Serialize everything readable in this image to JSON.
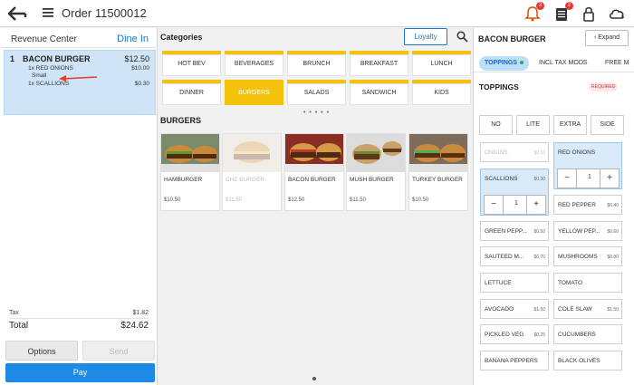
{
  "header": {
    "title": "Order 11500012",
    "notification_badge": "3",
    "orders_badge": "2",
    "badge_color": "#e53935"
  },
  "left_panel": {
    "revenue_center_label": "Revenue Center",
    "dine_in_label": "Dine In",
    "order_item": {
      "qty": "1",
      "name": "BACON BURGER",
      "price": "$12.50",
      "modifiers": [
        {
          "text": "1x RED ONIONS",
          "price": "$10.00"
        },
        {
          "text": "Small",
          "price": ""
        },
        {
          "text": "1x SCALLIONS",
          "price": "$0.30"
        }
      ]
    },
    "tax_label": "Tax",
    "tax_value": "$1.82",
    "total_label": "Total",
    "total_value": "$24.62",
    "options_label": "Options",
    "send_label": "Send",
    "pay_label": "Pay",
    "pay_color": "#1e88e5"
  },
  "middle_panel": {
    "categories_title": "Categories",
    "loyalty_label": "Loyalty",
    "categories": [
      {
        "label": "HOT BEV",
        "active": false
      },
      {
        "label": "BEVERAGES",
        "active": false
      },
      {
        "label": "BRUNCH",
        "active": false
      },
      {
        "label": "BREAKFAST",
        "active": false
      },
      {
        "label": "LUNCH",
        "active": false
      },
      {
        "label": "DINNER",
        "active": false
      },
      {
        "label": "BURGERS",
        "active": true
      },
      {
        "label": "SALADS",
        "active": false
      },
      {
        "label": "SANDWICH",
        "active": false
      },
      {
        "label": "KIDS",
        "active": false
      }
    ],
    "accent_color": "#f4c20d",
    "section_title": "BURGERS",
    "products": [
      {
        "name": "HAMBURGER",
        "price": "$10.50",
        "enabled": true
      },
      {
        "name": "CHZ BURGER",
        "price": "$11.50",
        "enabled": false
      },
      {
        "name": "BACON BURGER",
        "price": "$12.50",
        "enabled": true
      },
      {
        "name": "MUSH BURGER",
        "price": "$11.50",
        "enabled": true
      },
      {
        "name": "TURKEY BURGER",
        "price": "$10.50",
        "enabled": true
      }
    ]
  },
  "right_panel": {
    "title": "BACON BURGER",
    "expand_label": "Expand",
    "tabs": [
      "TOPPINGS",
      "INCL TAX MODS",
      "FREE M"
    ],
    "toppings_title": "TOPPINGS",
    "required_label": "REQUIRED",
    "size_options": [
      "NO",
      "LITE",
      "EXTRA",
      "SIDE"
    ],
    "toppings": [
      {
        "name": "ONIONS",
        "price": "$0.10",
        "state": "disabled"
      },
      {
        "name": "RED ONIONS",
        "price": "",
        "state": "selected",
        "qty": "1"
      },
      {
        "name": "SCALLIONS",
        "price": "$0.30",
        "state": "selected",
        "qty": "1"
      },
      {
        "name": "RED PEPPER",
        "price": "$0.40",
        "state": "normal"
      },
      {
        "name": "GREEN PEPP...",
        "price": "$0.50",
        "state": "normal"
      },
      {
        "name": "YELLOW PEP...",
        "price": "$0.60",
        "state": "normal"
      },
      {
        "name": "SAUTEED M...",
        "price": "$0.70",
        "state": "normal"
      },
      {
        "name": "MUSHROOMS",
        "price": "$0.80",
        "state": "normal"
      },
      {
        "name": "LETTUCE",
        "price": "",
        "state": "normal"
      },
      {
        "name": "TOMATO",
        "price": "",
        "state": "normal"
      },
      {
        "name": "AVOCADO",
        "price": "$1.50",
        "state": "normal"
      },
      {
        "name": "COLE SLAW",
        "price": "$1.50",
        "state": "normal"
      },
      {
        "name": "PICKLED VEG",
        "price": "$0.25",
        "state": "normal"
      },
      {
        "name": "CUCUMBERS",
        "price": "",
        "state": "normal"
      },
      {
        "name": "BANANA PEPPERS",
        "price": "",
        "state": "normal"
      },
      {
        "name": "BLACK OLIVES",
        "price": "",
        "state": "normal"
      }
    ]
  }
}
